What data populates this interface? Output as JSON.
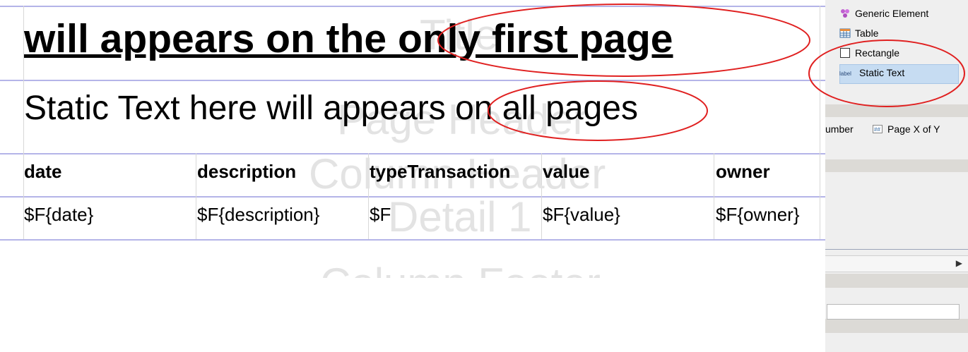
{
  "report": {
    "title_text": "will appears on the only first page",
    "page_header_text": "Static Text here will appears on all pages",
    "band_labels": {
      "title": "Title",
      "page_header": "Page Header",
      "column_header": "Column Header",
      "detail": "Detail 1",
      "column_footer": "Column Footer"
    },
    "columns": [
      {
        "header": "date",
        "field": "$F{date}"
      },
      {
        "header": "description",
        "field": "$F{description}"
      },
      {
        "header": "typeTransaction",
        "field": "$F"
      },
      {
        "header": "value",
        "field": "$F{value}"
      },
      {
        "header": "owner",
        "field": "$F{owner}"
      }
    ]
  },
  "palette": {
    "items": [
      {
        "label": "Generic Element",
        "icon": "generic-element-icon"
      },
      {
        "label": "Table",
        "icon": "table-icon"
      },
      {
        "label": "Rectangle",
        "icon": "rectangle-icon"
      },
      {
        "label": "Static Text",
        "icon": "static-text-icon",
        "selected": true
      }
    ],
    "row2": {
      "page_number_label": "umber",
      "page_x_of_y_label": "Page X of Y"
    },
    "expand_glyph": "▶"
  },
  "annotation_color": "#e02020",
  "selection_color": "#c6dcf2"
}
